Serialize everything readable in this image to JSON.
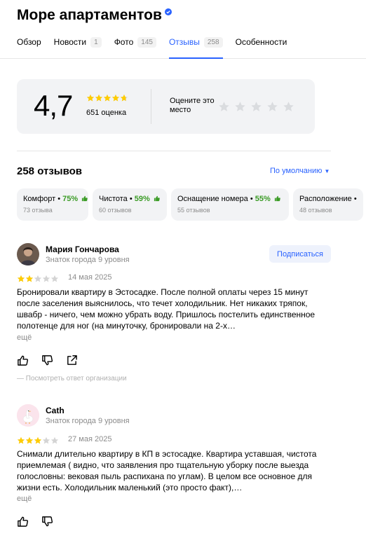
{
  "business": {
    "name": "Море апартаментов",
    "verified_icon": "verified-badge-icon"
  },
  "tabs": [
    {
      "label": "Обзор",
      "count": ""
    },
    {
      "label": "Новости",
      "count": "1"
    },
    {
      "label": "Фото",
      "count": "145"
    },
    {
      "label": "Отзывы",
      "count": "258",
      "active": true
    },
    {
      "label": "Особенности",
      "count": ""
    }
  ],
  "rating": {
    "value": "4,7",
    "stars": 4.7,
    "count_label": "651 оценка",
    "rate_prompt": "Оцените это место",
    "star_color": "#fc0",
    "empty_star_color": "#d4d4d4"
  },
  "reviews_header": {
    "title": "258 отзывов",
    "sort_label": "По умолчанию"
  },
  "aspects": [
    {
      "name": "Комфорт",
      "percent": "75%",
      "count": "73 отзыва"
    },
    {
      "name": "Чистота",
      "percent": "59%",
      "count": "60 отзывов"
    },
    {
      "name": "Оснащение номера",
      "percent": "55%",
      "count": "55 отзывов"
    },
    {
      "name": "Расположение",
      "percent": "",
      "count": "48 отзывов"
    }
  ],
  "reviews": [
    {
      "author": "Мария Гончарова",
      "level": "Знаток города 9 уровня",
      "subscribe_label": "Подписаться",
      "stars": 2,
      "date": "14 мая 2025",
      "text": "Бронировали квартиру в Эстосадке. После полной оплаты через 15 минут после заселения выяснилось, что течет холодильник. Нет никаких тряпок, швабр - ничего, чем можно убрать воду. Пришлось постелить единственное полотенце для ног (на минуточку, бронировали на 2-х…",
      "more_label": "ещё",
      "org_reply_label": "— Посмотреть ответ организации"
    },
    {
      "author": "Cath",
      "level": "Знаток города 9 уровня",
      "stars": 3,
      "date": "27 мая 2025",
      "text": "Снимали длительно квартиру в КП в эстосадке. Квартира уставшая, чистота приемлемая ( видно, что заявления про тщательную уборку после выезда голословны: вековая пыль распихана по углам). В целом все основное для жизни есть. Холодильник маленький (это просто факт),…",
      "more_label": "ещё"
    }
  ]
}
